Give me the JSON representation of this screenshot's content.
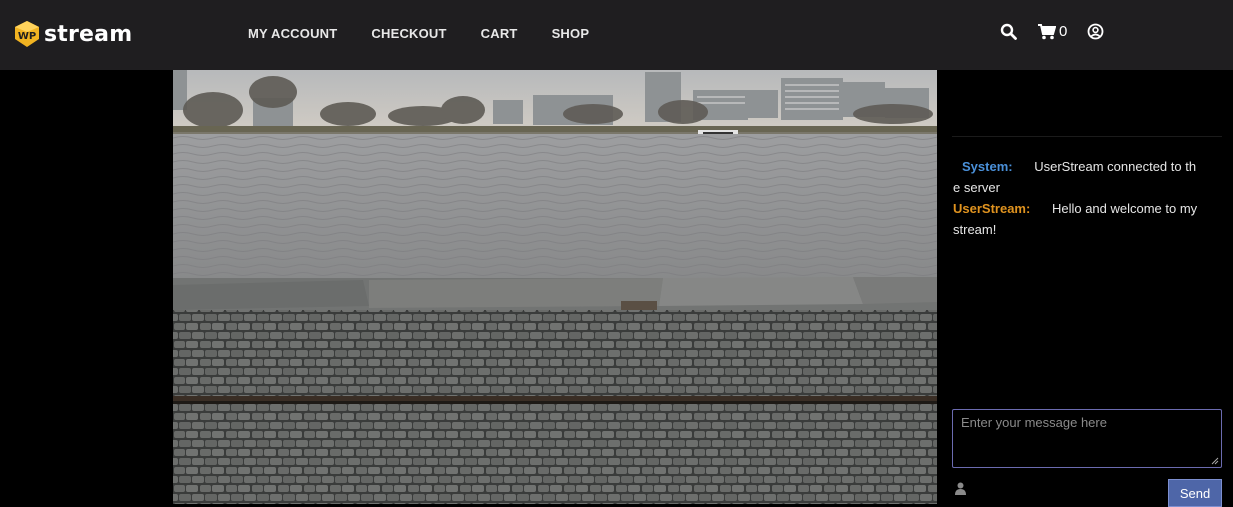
{
  "brand": {
    "logo_text": "stream",
    "logo_badge_text": "WP",
    "accent": "#f1b321"
  },
  "nav": [
    {
      "label": "MY ACCOUNT"
    },
    {
      "label": "CHECKOUT"
    },
    {
      "label": "CART"
    },
    {
      "label": "SHOP"
    }
  ],
  "header_icons": {
    "search": "search-icon",
    "cart": "cart-icon",
    "cart_count": "0",
    "account": "user-circle-icon"
  },
  "video": {
    "scene": "river-quay-stream"
  },
  "chat": {
    "messages": [
      {
        "user": "System:",
        "text": "UserStream connected to the server",
        "color": "#4a90d9"
      },
      {
        "user": "UserStream:",
        "text": "Hello and welcome to my stream!",
        "color": "#e0931f"
      }
    ],
    "input_placeholder": "Enter your message here",
    "send_label": "Send",
    "user_icon": "user-icon"
  }
}
